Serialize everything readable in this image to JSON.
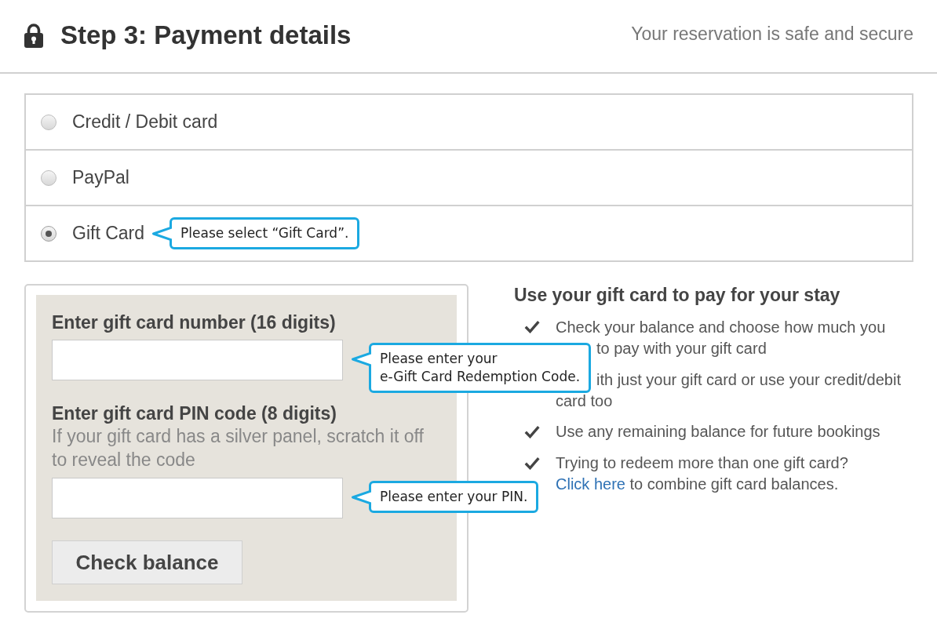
{
  "header": {
    "title": "Step 3: Payment details",
    "note": "Your reservation is safe and secure"
  },
  "payment_methods": [
    {
      "label": "Credit / Debit card",
      "selected": false
    },
    {
      "label": "PayPal",
      "selected": false
    },
    {
      "label": "Gift Card",
      "selected": true,
      "callout": "Please select “Gift Card”."
    }
  ],
  "gift_card_form": {
    "fields": [
      {
        "label": "Enter gift card number (16 digits)",
        "callout": "Please enter your\ne-Gift Card Redemption Code."
      },
      {
        "label": "Enter gift card PIN code (8 digits)",
        "help": "If your gift card has a silver panel, scratch it off to reveal the code",
        "callout": "Please enter your PIN."
      }
    ],
    "button": "Check balance"
  },
  "info": {
    "heading": "Use your gift card to pay for your stay",
    "items": [
      {
        "kind": "partly_covered",
        "lines": [
          {
            "text": "Check your balance and choose how much you"
          },
          {
            "text": "to pay with your gift card",
            "covered": true
          }
        ]
      },
      {
        "kind": "partly_covered",
        "lines": [
          {
            "text": "ith just your gift card or use your credit/debit",
            "covered": true
          },
          {
            "text": "card too"
          }
        ]
      },
      {
        "kind": "plain",
        "text": "Use any remaining balance for future bookings"
      },
      {
        "kind": "plain",
        "text": "Trying to redeem more than one gift card?",
        "link": "Click here",
        "text_after": "to combine gift card balances."
      }
    ]
  }
}
